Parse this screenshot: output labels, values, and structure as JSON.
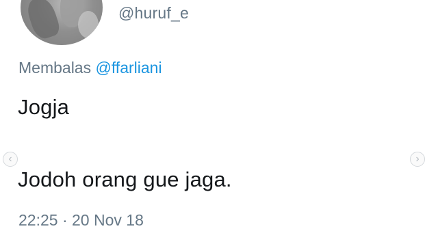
{
  "tweet": {
    "handle": "@huruf_e",
    "reply_prefix": "Membalas ",
    "reply_mention": "@ffarliani",
    "text_line_1": "Jogja",
    "text_line_2": "Jodoh orang gue jaga.",
    "time": "22:25",
    "separator": "·",
    "date": "20 Nov 18"
  },
  "carousel": {
    "prev_icon": "‹",
    "next_icon": "›"
  },
  "colors": {
    "secondary_text": "#657786",
    "mention": "#1b95e0",
    "primary_text": "#14171a"
  }
}
